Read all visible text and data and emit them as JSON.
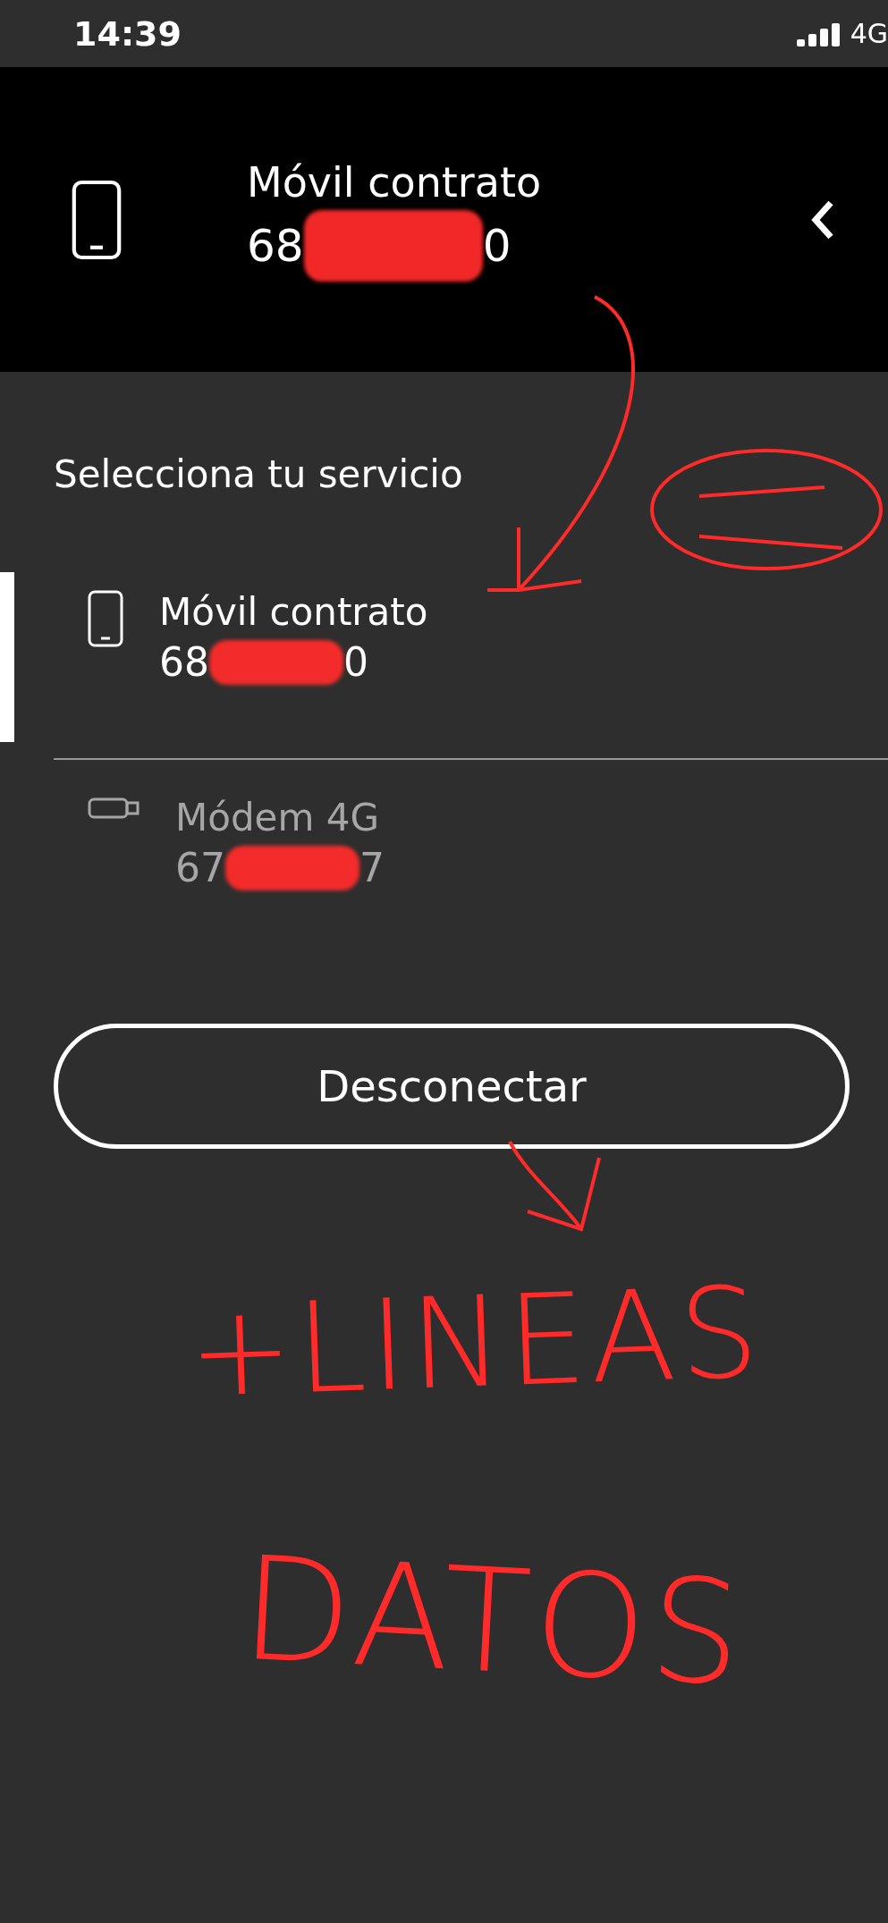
{
  "status_bar": {
    "time": "14:39",
    "network": "4G"
  },
  "header": {
    "title": "Móvil contrato",
    "number_parts": [
      "68",
      "0"
    ]
  },
  "section_title": "Selecciona tu servicio",
  "services": [
    {
      "kind": "phone",
      "name": "Móvil contrato",
      "number_parts": [
        "68",
        "0"
      ],
      "selected": true
    },
    {
      "kind": "modem",
      "name": "Módem 4G",
      "number_parts": [
        "67",
        "7"
      ],
      "selected": false
    }
  ],
  "disconnect_button": "Desconectar",
  "annotations": [
    "+LINEAS",
    "DATOS"
  ]
}
